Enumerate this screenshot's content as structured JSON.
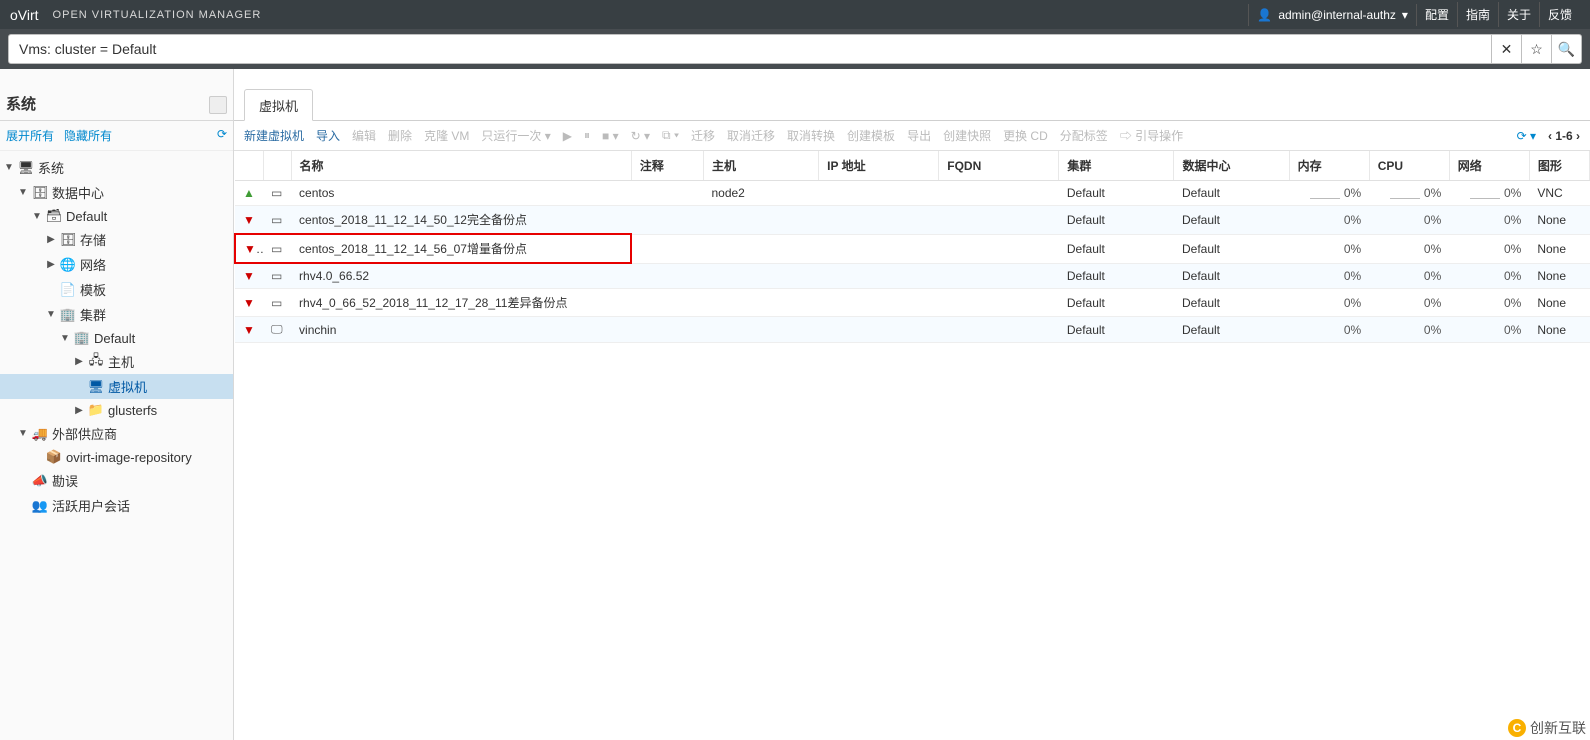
{
  "header": {
    "brand": "oVirt",
    "subtitle": "OPEN VIRTUALIZATION MANAGER",
    "user": "admin@internal-authz",
    "links": [
      "配置",
      "指南",
      "关于",
      "反馈"
    ]
  },
  "search": {
    "value": "Vms: cluster = Default"
  },
  "sidebar": {
    "title": "系统",
    "expand_all": "展开所有",
    "collapse_all": "隐藏所有",
    "tree": [
      {
        "indent": 0,
        "toggle": "▼",
        "icon": "system",
        "label": "系统"
      },
      {
        "indent": 1,
        "toggle": "▼",
        "icon": "dc",
        "label": "数据中心"
      },
      {
        "indent": 2,
        "toggle": "▼",
        "icon": "storage-domain",
        "label": "Default"
      },
      {
        "indent": 3,
        "toggle": "▶",
        "icon": "storage",
        "label": "存储"
      },
      {
        "indent": 3,
        "toggle": "▶",
        "icon": "network",
        "label": "网络"
      },
      {
        "indent": 3,
        "toggle": "",
        "icon": "template",
        "label": "模板"
      },
      {
        "indent": 3,
        "toggle": "▼",
        "icon": "cluster",
        "label": "集群"
      },
      {
        "indent": 4,
        "toggle": "▼",
        "icon": "cluster",
        "label": "Default"
      },
      {
        "indent": 5,
        "toggle": "▶",
        "icon": "host",
        "label": "主机"
      },
      {
        "indent": 5,
        "toggle": "",
        "icon": "vm",
        "label": "虚拟机",
        "selected": true
      },
      {
        "indent": 5,
        "toggle": "▶",
        "icon": "gluster",
        "label": "glusterfs"
      },
      {
        "indent": 1,
        "toggle": "▼",
        "icon": "provider",
        "label": "外部供应商"
      },
      {
        "indent": 2,
        "toggle": "",
        "icon": "repo",
        "label": "ovirt-image-repository"
      },
      {
        "indent": 1,
        "toggle": "",
        "icon": "errata",
        "label": "勘误"
      },
      {
        "indent": 1,
        "toggle": "",
        "icon": "session",
        "label": "活跃用户会话"
      }
    ]
  },
  "tab": {
    "label": "虚拟机"
  },
  "toolbar": {
    "items": [
      {
        "label": "新建虚拟机",
        "enabled": true
      },
      {
        "label": "导入",
        "enabled": true
      },
      {
        "label": "编辑",
        "enabled": false
      },
      {
        "label": "删除",
        "enabled": false
      },
      {
        "label": "克隆 VM",
        "enabled": false
      },
      {
        "label": "只运行一次",
        "enabled": false,
        "dropdown": true
      },
      {
        "label": "▶",
        "enabled": false
      },
      {
        "label": "⏸",
        "enabled": false
      },
      {
        "label": "■",
        "enabled": false,
        "dropdown": true
      },
      {
        "label": "↻",
        "enabled": false,
        "dropdown": true
      },
      {
        "label": "⧉",
        "enabled": false,
        "dropdown": true
      },
      {
        "label": "迁移",
        "enabled": false
      },
      {
        "label": "取消迁移",
        "enabled": false
      },
      {
        "label": "取消转换",
        "enabled": false
      },
      {
        "label": "创建模板",
        "enabled": false
      },
      {
        "label": "导出",
        "enabled": false
      },
      {
        "label": "创建快照",
        "enabled": false
      },
      {
        "label": "更换 CD",
        "enabled": false
      },
      {
        "label": "分配标签",
        "enabled": false
      },
      {
        "label": "引导操作",
        "enabled": false,
        "icon": true
      }
    ],
    "pager": "1-6"
  },
  "columns": [
    "",
    "",
    "名称",
    "注释",
    "主机",
    "IP 地址",
    "FQDN",
    "集群",
    "数据中心",
    "内存",
    "CPU",
    "网络",
    "图形"
  ],
  "rows": [
    {
      "status": "up",
      "name": "centos",
      "host": "node2",
      "cluster": "Default",
      "dc": "Default",
      "mem": "0%",
      "cpu": "0%",
      "net": "0%",
      "graphics": "VNC",
      "spark": true
    },
    {
      "status": "down",
      "name": "centos_2018_11_12_14_50_12完全备份点",
      "host": "",
      "cluster": "Default",
      "dc": "Default",
      "mem": "0%",
      "cpu": "0%",
      "net": "0%",
      "graphics": "None"
    },
    {
      "status": "down",
      "name": "centos_2018_11_12_14_56_07增量备份点",
      "host": "",
      "cluster": "Default",
      "dc": "Default",
      "mem": "0%",
      "cpu": "0%",
      "net": "0%",
      "graphics": "None",
      "highlight": true
    },
    {
      "status": "down",
      "name": "rhv4.0_66.52",
      "host": "",
      "cluster": "Default",
      "dc": "Default",
      "mem": "0%",
      "cpu": "0%",
      "net": "0%",
      "graphics": "None"
    },
    {
      "status": "down",
      "name": "rhv4_0_66_52_2018_11_12_17_28_11差异备份点",
      "host": "",
      "cluster": "Default",
      "dc": "Default",
      "mem": "0%",
      "cpu": "0%",
      "net": "0%",
      "graphics": "None"
    },
    {
      "status": "down",
      "name": "vinchin",
      "host": "",
      "cluster": "Default",
      "dc": "Default",
      "mem": "0%",
      "cpu": "0%",
      "net": "0%",
      "graphics": "None",
      "vmicon": "monitor"
    }
  ],
  "watermark": "创新互联"
}
